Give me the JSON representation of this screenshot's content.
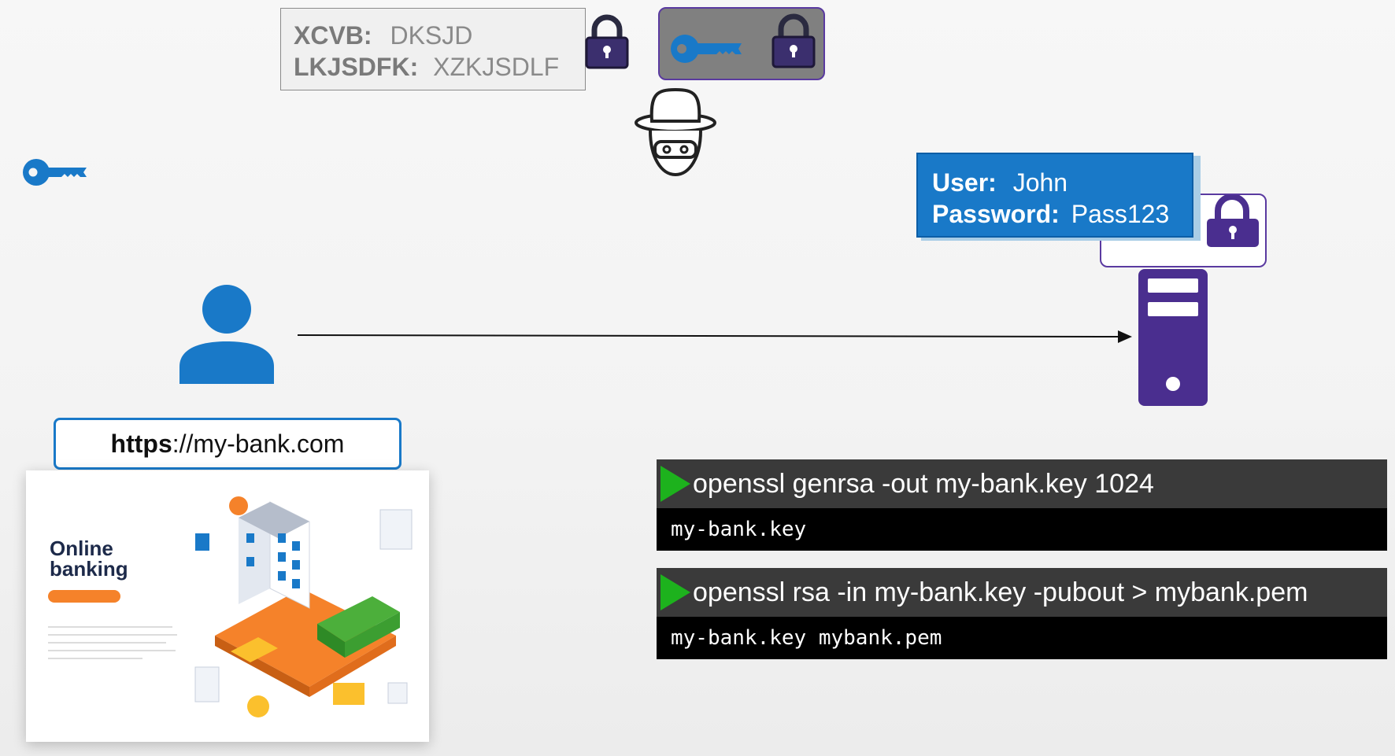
{
  "encrypted_box": {
    "line1": {
      "label": "XCVB:",
      "value": "DKSJD"
    },
    "line2": {
      "label": "LKJSDFK:",
      "value": "XZKJSDLF"
    }
  },
  "credentials": {
    "user_label": "User:",
    "user_value": "John",
    "password_label": "Password:",
    "password_value": "Pass123"
  },
  "url_bar": {
    "scheme": "https",
    "rest": "://my-bank.com"
  },
  "website": {
    "title_line1": "Online",
    "title_line2": "banking"
  },
  "terminal": [
    {
      "command": "openssl genrsa -out my-bank.key 1024",
      "output": "my-bank.key"
    },
    {
      "command": "openssl rsa -in my-bank.key -pubout > mybank.pem",
      "output": "my-bank.key mybank.pem"
    }
  ],
  "colors": {
    "accent_blue": "#1979c8",
    "server_purple": "#4a2e8f",
    "panel_border": "#5a3aa0",
    "play_green": "#1db21d"
  },
  "icons": [
    "key-icon",
    "lock-icon",
    "hacker-icon",
    "user-icon",
    "server-icon"
  ]
}
